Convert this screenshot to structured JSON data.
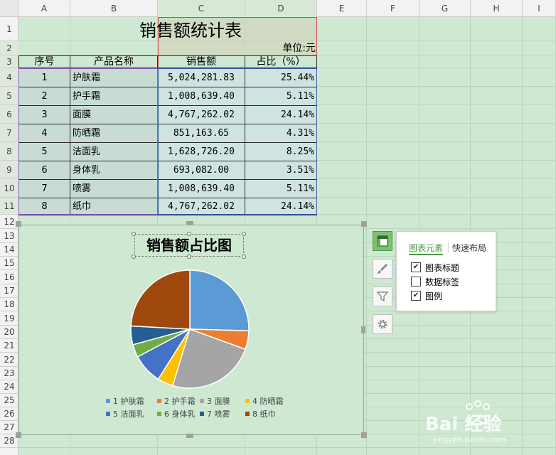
{
  "columns": [
    "A",
    "B",
    "C",
    "D",
    "E",
    "F",
    "G",
    "H",
    "I"
  ],
  "rows": [
    "1",
    "2",
    "3",
    "4",
    "5",
    "6",
    "7",
    "8",
    "9",
    "10",
    "11",
    "12",
    "13",
    "14",
    "15",
    "16",
    "17",
    "18",
    "19",
    "20",
    "21",
    "22",
    "23",
    "24",
    "25",
    "26",
    "27",
    "28"
  ],
  "sheet": {
    "title": "销售额统计表",
    "unit": "单位:元",
    "headers": [
      "序号",
      "产品名称",
      "销售额",
      "占比（%）"
    ],
    "table": [
      {
        "no": "1",
        "name": "护肤霜",
        "sales": "5,024,281.83",
        "pct": "25.44%"
      },
      {
        "no": "2",
        "name": "护手霜",
        "sales": "1,008,639.40",
        "pct": "5.11%"
      },
      {
        "no": "3",
        "name": "面膜",
        "sales": "4,767,262.02",
        "pct": "24.14%"
      },
      {
        "no": "4",
        "name": "防晒霜",
        "sales": "851,163.65",
        "pct": "4.31%"
      },
      {
        "no": "5",
        "name": "洁面乳",
        "sales": "1,628,726.20",
        "pct": "8.25%"
      },
      {
        "no": "6",
        "name": "身体乳",
        "sales": "693,082.00",
        "pct": "3.51%"
      },
      {
        "no": "7",
        "name": "喷雾",
        "sales": "1,008,639.40",
        "pct": "5.11%"
      },
      {
        "no": "8",
        "name": "纸巾",
        "sales": "4,767,262.02",
        "pct": "24.14%"
      }
    ]
  },
  "panel": {
    "tab_elements": "图表元素",
    "tab_layout": "快速布局",
    "options": [
      {
        "label": "图表标题",
        "checked": true
      },
      {
        "label": "数据标签",
        "checked": false
      },
      {
        "label": "图例",
        "checked": true
      }
    ]
  },
  "icons": {
    "chart_elements": "chart-elements-icon",
    "chart_style": "brush-icon",
    "chart_filter": "filter-icon",
    "chart_settings": "gear-icon"
  },
  "colors": {
    "accent": "#4a9a3f",
    "selection": "#3c5aa8",
    "selection_alt": "#d24a4a"
  },
  "chart_data": {
    "type": "pie",
    "title": "销售额占比图",
    "categories": [
      "1 护肤霜",
      "2 护手霜",
      "3 面膜",
      "4 防晒霜",
      "5 洁面乳",
      "6 身体乳",
      "7 喷雾",
      "8 纸巾"
    ],
    "values": [
      25.44,
      5.11,
      24.14,
      4.31,
      8.25,
      3.51,
      5.11,
      24.14
    ],
    "colors": [
      "#5b9bd5",
      "#ed7d31",
      "#a5a5a5",
      "#ffc000",
      "#4472c4",
      "#70ad47",
      "#255e91",
      "#9e480e"
    ],
    "legend": "bottom"
  },
  "watermark": {
    "brand": "Bai 经验",
    "url": "jingyan.baidu.com"
  }
}
